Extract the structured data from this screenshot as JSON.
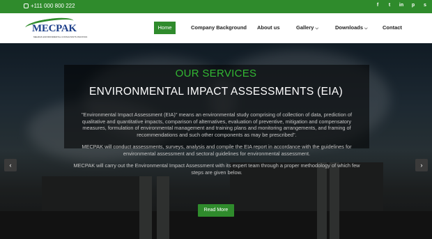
{
  "topbar": {
    "phone": "+111 000 800 222",
    "socials": [
      {
        "icon": "facebook-icon",
        "glyph": "f"
      },
      {
        "icon": "twitter-icon",
        "glyph": "t"
      },
      {
        "icon": "linkedin-icon",
        "glyph": "in"
      },
      {
        "icon": "pinterest-icon",
        "glyph": "p"
      },
      {
        "icon": "skype-icon",
        "glyph": "s"
      }
    ]
  },
  "logo": {
    "text": "MECPAK",
    "tagline": "MEHRAN ENVIRONMENTAL CONSULTANTS PAKISTAN"
  },
  "nav": {
    "home": "Home",
    "company_background": "Company Background",
    "about": "About us",
    "gallery": "Gallery",
    "downloads": "Downloads",
    "contact": "Contact"
  },
  "hero": {
    "kicker": "OUR SERVICES",
    "title": "ENVIRONMENTAL IMPACT ASSESSMENTS (EIA)",
    "paragraphs": [
      "\"Environmental Impact Assessment (EIA)\" means an environmental study comprising of collection of data, prediction of qualitative and quantitative impacts, comparison of alternatives, evaluation of preventive, mitigation and compensatory measures, formulation of environmental management and training plans and monitoring arrangements, and framing of recommendations and such other components as may be prescribed\".",
      "MECPAK will conduct assessments, surveys, analysis and compile the EIA report in accordance with the guidelines for environmental assessment and sectoral guidelines for environmental assessment.",
      "MECPAK will carry out the Environmental Impact Assessment with its expert team through a proper methodology of which few steps are given below."
    ],
    "read_more": "Read More"
  },
  "slider": {
    "prev": "‹",
    "next": "›"
  },
  "colors": {
    "brand_green": "#2f8b2c",
    "kicker_green": "#33b833",
    "logo_blue": "#1d3f8a"
  }
}
